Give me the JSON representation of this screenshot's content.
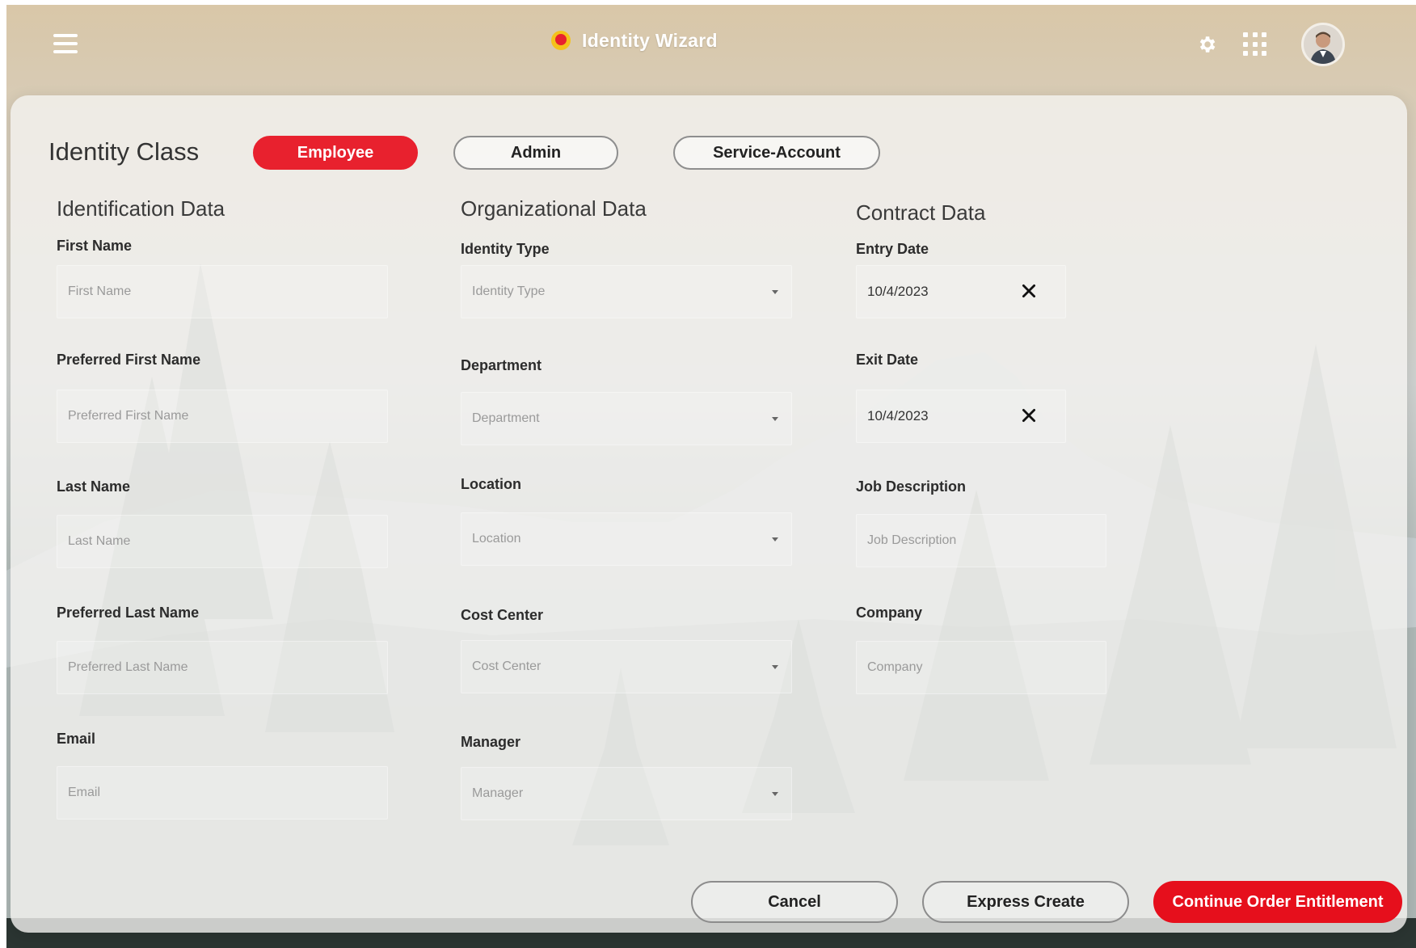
{
  "header": {
    "title": "Identity Wizard",
    "menu_icon": "hamburger-menu-icon",
    "settings_icon": "gear-icon",
    "apps_icon": "app-grid-icon",
    "avatar_icon": "user-avatar"
  },
  "identity_class": {
    "label": "Identity Class",
    "options": [
      {
        "label": "Employee",
        "selected": true
      },
      {
        "label": "Admin",
        "selected": false
      },
      {
        "label": "Service-Account",
        "selected": false
      }
    ]
  },
  "identification": {
    "title": "Identification Data",
    "fields": [
      {
        "label": "First Name",
        "placeholder": "First Name",
        "value": ""
      },
      {
        "label": "Preferred First Name",
        "placeholder": "Preferred First Name",
        "value": ""
      },
      {
        "label": "Last Name",
        "placeholder": "Last Name",
        "value": ""
      },
      {
        "label": "Preferred Last Name",
        "placeholder": "Preferred Last Name",
        "value": ""
      },
      {
        "label": "Email",
        "placeholder": "Email",
        "value": ""
      }
    ]
  },
  "organizational": {
    "title": "Organizational Data",
    "fields": [
      {
        "label": "Identity Type",
        "placeholder": "Identity Type",
        "type": "select"
      },
      {
        "label": "Department",
        "placeholder": "Department",
        "type": "select"
      },
      {
        "label": "Location",
        "placeholder": "Location",
        "type": "select"
      },
      {
        "label": "Cost Center",
        "placeholder": "Cost Center",
        "type": "select"
      },
      {
        "label": "Manager",
        "placeholder": "Manager",
        "type": "select"
      }
    ]
  },
  "contract": {
    "title": "Contract Data",
    "fields": [
      {
        "label": "Entry Date",
        "value": "10/4/2023",
        "type": "date"
      },
      {
        "label": "Exit Date",
        "value": "10/4/2023",
        "type": "date"
      },
      {
        "label": "Job Description",
        "placeholder": "Job Description",
        "value": ""
      },
      {
        "label": "Company",
        "placeholder": "Company",
        "value": ""
      }
    ]
  },
  "actions": {
    "cancel": "Cancel",
    "express_create": "Express Create",
    "continue": "Continue Order Entitlement"
  },
  "colors": {
    "accent": "#e8212e",
    "primary_button": "#e60f1c"
  }
}
